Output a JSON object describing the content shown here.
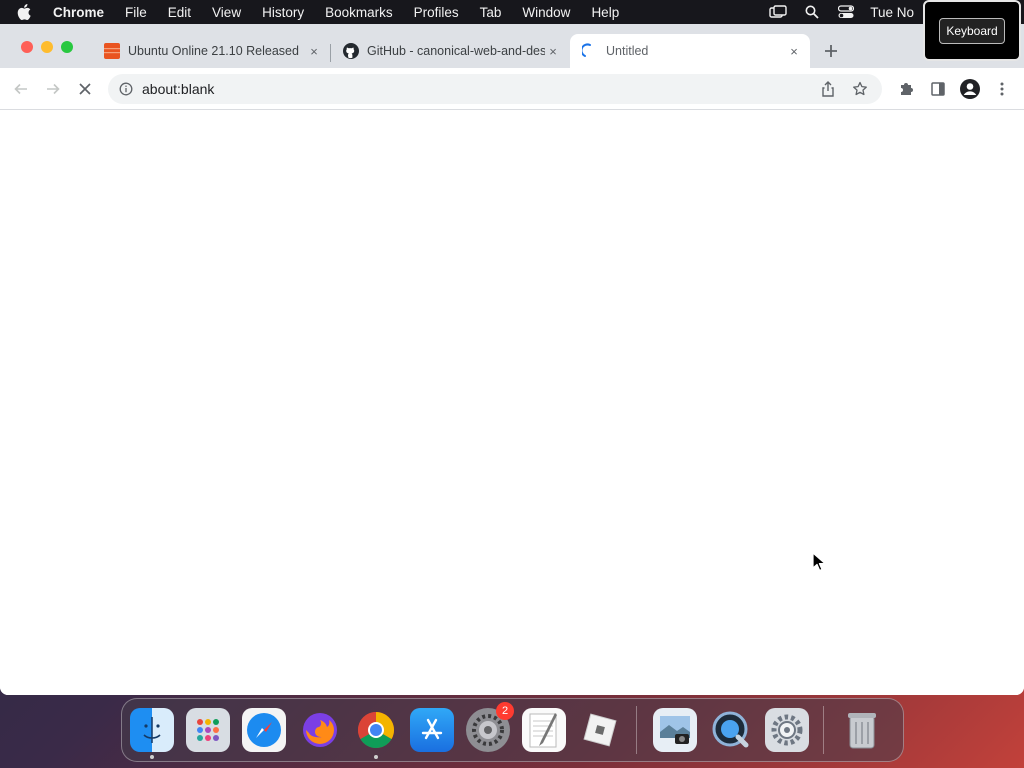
{
  "menubar": {
    "app_name": "Chrome",
    "items": [
      "File",
      "Edit",
      "View",
      "History",
      "Bookmarks",
      "Profiles",
      "Tab",
      "Window",
      "Help"
    ],
    "clock": "Tue No",
    "keyboard_label": "Keyboard"
  },
  "tabs": [
    {
      "title": "Ubuntu Online 21.10 Released",
      "favicon": "ubuntu-icon",
      "close": "×"
    },
    {
      "title": "GitHub - canonical-web-and-design",
      "favicon": "github-icon",
      "close": "×"
    },
    {
      "title": "Untitled",
      "favicon": "loading-spinner-icon",
      "close": "×",
      "active": true
    }
  ],
  "toolbar": {
    "url": "about:blank"
  },
  "dock": {
    "apps": [
      "Finder",
      "Launchpad",
      "Safari",
      "Firefox",
      "Chrome",
      "App Store",
      "System Preferences",
      "TextEdit",
      "Roblox",
      "Preview",
      "QuickTime Player",
      "System Preferences"
    ],
    "badge_count": "2"
  },
  "colors": {
    "menubar_bg": "#17171c",
    "tabstrip_bg": "#dee1e6",
    "omnibox_bg": "#f1f3f4",
    "close_red": "#fe5f57",
    "minimize_yellow": "#febc2e",
    "maximize_green": "#28c840"
  }
}
